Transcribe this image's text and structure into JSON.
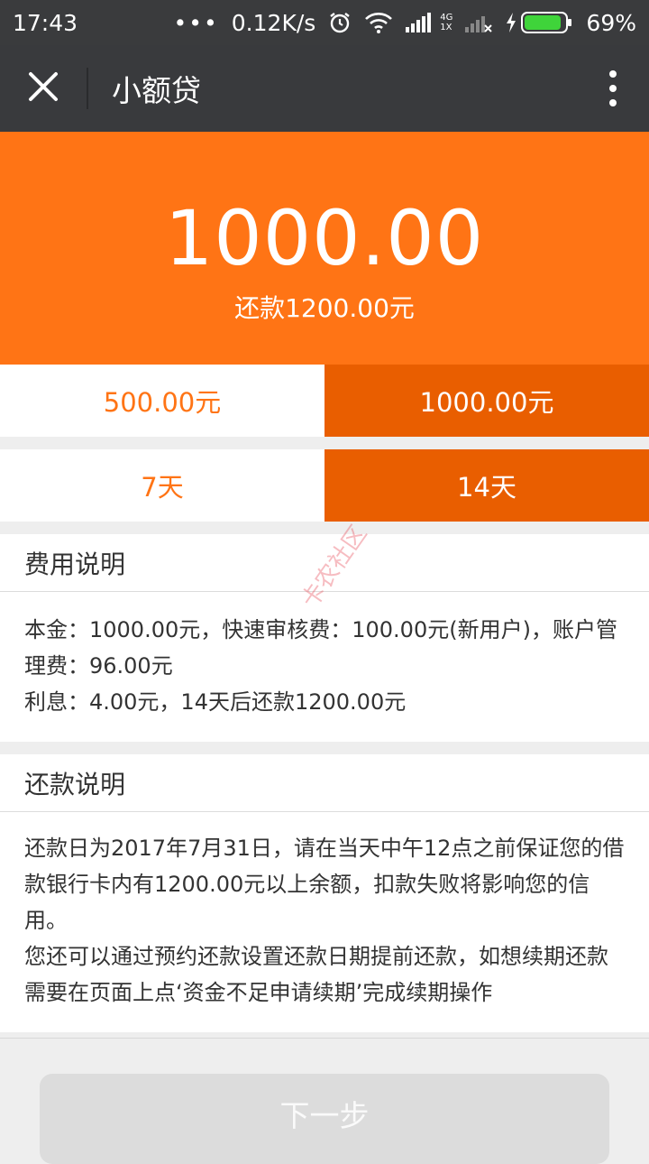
{
  "status": {
    "time": "17:43",
    "net_speed": "0.12K/s",
    "net_type": "4G",
    "net_type2": "1X",
    "battery": "69%"
  },
  "nav": {
    "title": "小额贷"
  },
  "hero": {
    "amount": "1000.00",
    "repay_text": "还款1200.00元"
  },
  "amount_options": [
    {
      "label": "500.00元",
      "selected": false
    },
    {
      "label": "1000.00元",
      "selected": true
    }
  ],
  "term_options": [
    {
      "label": "7天",
      "selected": false
    },
    {
      "label": "14天",
      "selected": true
    }
  ],
  "fee_section": {
    "title": "费用说明",
    "line1": "本金：1000.00元，快速审核费：100.00元(新用户)，账户管理费：96.00元",
    "line2": "利息：4.00元，14天后还款1200.00元"
  },
  "repay_section": {
    "title": "还款说明",
    "para1": "还款日为2017年7月31日，请在当天中午12点之前保证您的借款银行卡内有1200.00元以上余额，扣款失败将影响您的信用。",
    "para2": "您还可以通过预约还款设置还款日期提前还款，如想续期还款需要在页面上点‘资金不足申请续期’完成续期操作"
  },
  "footer": {
    "next_label": "下一步"
  },
  "watermark": {
    "text": "卡农社区"
  },
  "colors": {
    "accent": "#ff7415",
    "accent_dark": "#e95e00",
    "nav_bg": "#393a3d"
  }
}
